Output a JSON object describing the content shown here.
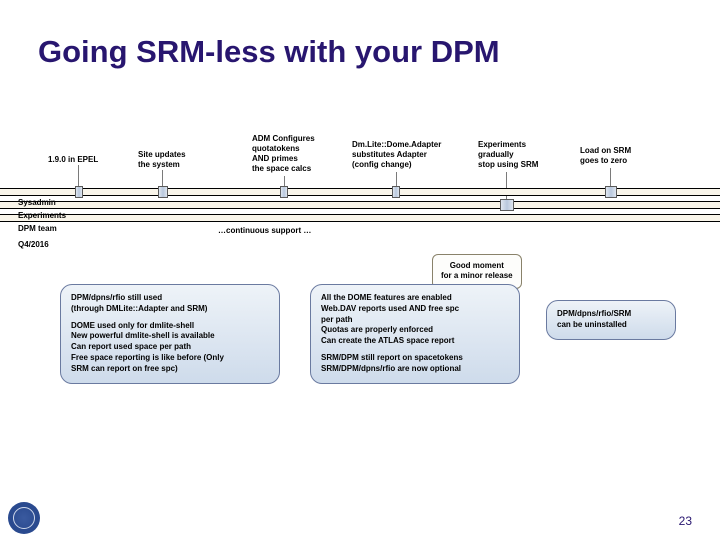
{
  "title": "Going SRM-less with your DPM",
  "rows": {
    "r1": "Sysadmin",
    "r2": "Experiments",
    "r3": "DPM team"
  },
  "ann": {
    "a1": "1.9.0 in EPEL",
    "a2": "Site updates\nthe system",
    "a3": "ADM Configures\nquotatokens\nAND primes\nthe space calcs",
    "a4": "Dm.Lite::Dome.Adapter\nsubstitutes Adapter\n(config change)",
    "a5": "Experiments\ngradually\nstop using SRM",
    "a6": "Load on SRM\ngoes to zero"
  },
  "support": "…continuous support …",
  "q4": "Q4/2016",
  "balloon": "Good moment\nfor a minor release",
  "clouds": {
    "c1": [
      "DPM/dpns/rfio still used",
      "(through DMLite::Adapter and SRM)",
      "",
      "DOME used only for dmlite-shell",
      "New powerful dmlite-shell is available",
      "Can report used space per path",
      "Free space reporting is like before (Only",
      "SRM can report on free spc)"
    ],
    "c2": [
      "All the DOME features are enabled",
      "Web.DAV reports used AND free spc",
      "per path",
      "Quotas are properly enforced",
      "Can create the ATLAS space report",
      "",
      "SRM/DPM still report on spacetokens",
      "SRM/DPM/dpns/rfio are now optional"
    ],
    "c3": [
      "DPM/dpns/rfio/SRM",
      "can be uninstalled"
    ]
  },
  "page": "23"
}
